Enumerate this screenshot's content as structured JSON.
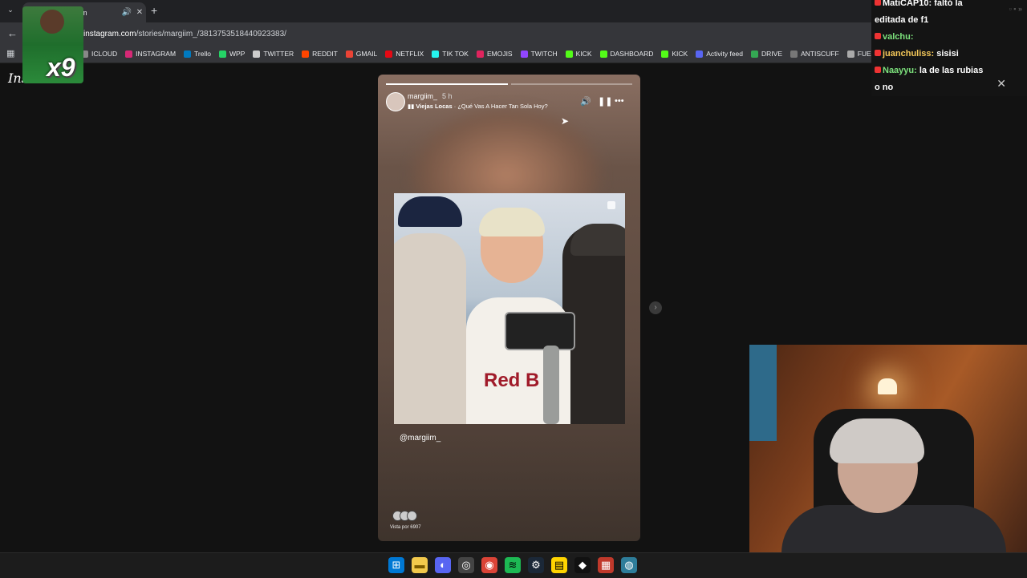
{
  "browser": {
    "tab_title": "gram",
    "url_domain": "instagram.com",
    "url_path": "/stories/margiim_/3813753518440923383/"
  },
  "bookmarks": [
    {
      "label": "ICLOUD",
      "color": "#888888"
    },
    {
      "label": "INSTAGRAM",
      "color": "#d62976"
    },
    {
      "label": "Trello",
      "color": "#0079bf"
    },
    {
      "label": "WPP",
      "color": "#25d366"
    },
    {
      "label": "TWITTER",
      "color": "#cccccc"
    },
    {
      "label": "REDDIT",
      "color": "#ff4500"
    },
    {
      "label": "GMAIL",
      "color": "#ea4335"
    },
    {
      "label": "NETFLIX",
      "color": "#e50914"
    },
    {
      "label": "TIK TOK",
      "color": "#25f4ee"
    },
    {
      "label": "EMOJIS",
      "color": "#e0245e"
    },
    {
      "label": "TWITCH",
      "color": "#9146ff"
    },
    {
      "label": "KICK",
      "color": "#53fc18"
    },
    {
      "label": "DASHBOARD",
      "color": "#53fc18"
    },
    {
      "label": "KICK",
      "color": "#53fc18"
    },
    {
      "label": "Activity feed",
      "color": "#5865f2"
    },
    {
      "label": "DRIVE",
      "color": "#34a853"
    },
    {
      "label": "ANTISCUFF",
      "color": "#777777"
    },
    {
      "label": "FUENTES",
      "color": "#aaaaaa"
    }
  ],
  "page": {
    "logo": "Insta",
    "overlay_text": "x9"
  },
  "story": {
    "username": "margiim_",
    "time": "5 h",
    "song_artist": "Viejas Locas",
    "song_title": "¿Qué Vas A Hacer Tan Sola Hoy?",
    "mention": "@margiim_",
    "seen_by": "Vista por 6907",
    "progress_segments": 2,
    "progress_done": 1
  },
  "chat": {
    "messages": [
      {
        "user": "MatiCAP10:",
        "text": "faltó la",
        "user_style": "user3"
      },
      {
        "user": "",
        "text": "editada de f1",
        "user_style": "user3"
      },
      {
        "user": "valchu:",
        "text": "",
        "user_style": "user"
      },
      {
        "user": "juanchuliss:",
        "text": "sisisi",
        "user_style": "user2"
      },
      {
        "user": "Naayyu:",
        "text": "la de las rubias",
        "user_style": "user"
      },
      {
        "user": "",
        "text": "o no",
        "user_style": "user3"
      }
    ]
  }
}
